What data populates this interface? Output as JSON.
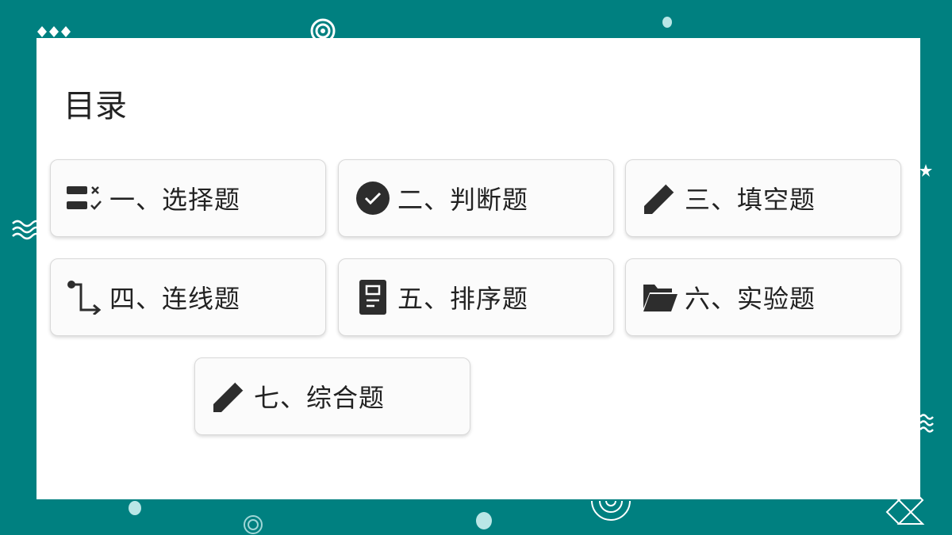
{
  "page": {
    "title": "目录",
    "background_color": "#008080",
    "panel_color": "#ffffff"
  },
  "toc": {
    "items": [
      {
        "label": "一、选择题",
        "icon": "checklist-icon"
      },
      {
        "label": "二、判断题",
        "icon": "check-circle-icon"
      },
      {
        "label": "三、填空题",
        "icon": "pencil-icon"
      },
      {
        "label": "四、连线题",
        "icon": "route-arrow-icon"
      },
      {
        "label": "五、排序题",
        "icon": "document-icon"
      },
      {
        "label": "六、实验题",
        "icon": "folder-open-icon"
      },
      {
        "label": "七、综合题",
        "icon": "pencil-icon"
      }
    ]
  }
}
